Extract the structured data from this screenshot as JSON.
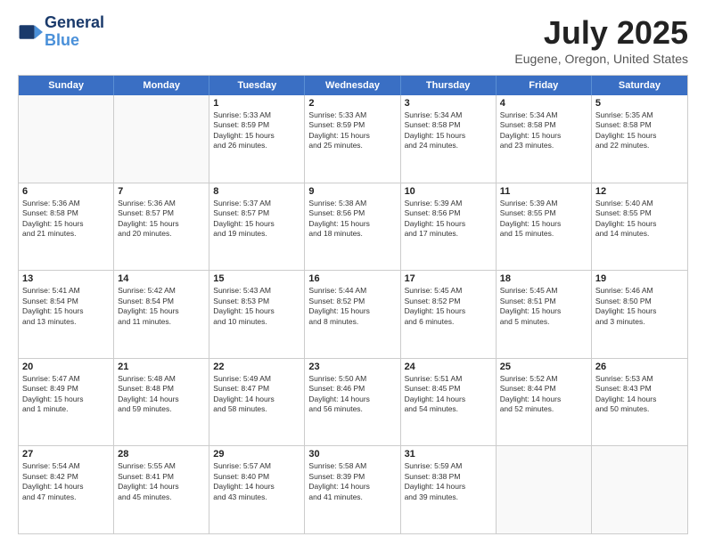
{
  "header": {
    "logo_line1": "General",
    "logo_line2": "Blue",
    "month_title": "July 2025",
    "location": "Eugene, Oregon, United States"
  },
  "days_of_week": [
    "Sunday",
    "Monday",
    "Tuesday",
    "Wednesday",
    "Thursday",
    "Friday",
    "Saturday"
  ],
  "weeks": [
    [
      {
        "day": "",
        "text": ""
      },
      {
        "day": "",
        "text": ""
      },
      {
        "day": "1",
        "text": "Sunrise: 5:33 AM\nSunset: 8:59 PM\nDaylight: 15 hours\nand 26 minutes."
      },
      {
        "day": "2",
        "text": "Sunrise: 5:33 AM\nSunset: 8:59 PM\nDaylight: 15 hours\nand 25 minutes."
      },
      {
        "day": "3",
        "text": "Sunrise: 5:34 AM\nSunset: 8:58 PM\nDaylight: 15 hours\nand 24 minutes."
      },
      {
        "day": "4",
        "text": "Sunrise: 5:34 AM\nSunset: 8:58 PM\nDaylight: 15 hours\nand 23 minutes."
      },
      {
        "day": "5",
        "text": "Sunrise: 5:35 AM\nSunset: 8:58 PM\nDaylight: 15 hours\nand 22 minutes."
      }
    ],
    [
      {
        "day": "6",
        "text": "Sunrise: 5:36 AM\nSunset: 8:58 PM\nDaylight: 15 hours\nand 21 minutes."
      },
      {
        "day": "7",
        "text": "Sunrise: 5:36 AM\nSunset: 8:57 PM\nDaylight: 15 hours\nand 20 minutes."
      },
      {
        "day": "8",
        "text": "Sunrise: 5:37 AM\nSunset: 8:57 PM\nDaylight: 15 hours\nand 19 minutes."
      },
      {
        "day": "9",
        "text": "Sunrise: 5:38 AM\nSunset: 8:56 PM\nDaylight: 15 hours\nand 18 minutes."
      },
      {
        "day": "10",
        "text": "Sunrise: 5:39 AM\nSunset: 8:56 PM\nDaylight: 15 hours\nand 17 minutes."
      },
      {
        "day": "11",
        "text": "Sunrise: 5:39 AM\nSunset: 8:55 PM\nDaylight: 15 hours\nand 15 minutes."
      },
      {
        "day": "12",
        "text": "Sunrise: 5:40 AM\nSunset: 8:55 PM\nDaylight: 15 hours\nand 14 minutes."
      }
    ],
    [
      {
        "day": "13",
        "text": "Sunrise: 5:41 AM\nSunset: 8:54 PM\nDaylight: 15 hours\nand 13 minutes."
      },
      {
        "day": "14",
        "text": "Sunrise: 5:42 AM\nSunset: 8:54 PM\nDaylight: 15 hours\nand 11 minutes."
      },
      {
        "day": "15",
        "text": "Sunrise: 5:43 AM\nSunset: 8:53 PM\nDaylight: 15 hours\nand 10 minutes."
      },
      {
        "day": "16",
        "text": "Sunrise: 5:44 AM\nSunset: 8:52 PM\nDaylight: 15 hours\nand 8 minutes."
      },
      {
        "day": "17",
        "text": "Sunrise: 5:45 AM\nSunset: 8:52 PM\nDaylight: 15 hours\nand 6 minutes."
      },
      {
        "day": "18",
        "text": "Sunrise: 5:45 AM\nSunset: 8:51 PM\nDaylight: 15 hours\nand 5 minutes."
      },
      {
        "day": "19",
        "text": "Sunrise: 5:46 AM\nSunset: 8:50 PM\nDaylight: 15 hours\nand 3 minutes."
      }
    ],
    [
      {
        "day": "20",
        "text": "Sunrise: 5:47 AM\nSunset: 8:49 PM\nDaylight: 15 hours\nand 1 minute."
      },
      {
        "day": "21",
        "text": "Sunrise: 5:48 AM\nSunset: 8:48 PM\nDaylight: 14 hours\nand 59 minutes."
      },
      {
        "day": "22",
        "text": "Sunrise: 5:49 AM\nSunset: 8:47 PM\nDaylight: 14 hours\nand 58 minutes."
      },
      {
        "day": "23",
        "text": "Sunrise: 5:50 AM\nSunset: 8:46 PM\nDaylight: 14 hours\nand 56 minutes."
      },
      {
        "day": "24",
        "text": "Sunrise: 5:51 AM\nSunset: 8:45 PM\nDaylight: 14 hours\nand 54 minutes."
      },
      {
        "day": "25",
        "text": "Sunrise: 5:52 AM\nSunset: 8:44 PM\nDaylight: 14 hours\nand 52 minutes."
      },
      {
        "day": "26",
        "text": "Sunrise: 5:53 AM\nSunset: 8:43 PM\nDaylight: 14 hours\nand 50 minutes."
      }
    ],
    [
      {
        "day": "27",
        "text": "Sunrise: 5:54 AM\nSunset: 8:42 PM\nDaylight: 14 hours\nand 47 minutes."
      },
      {
        "day": "28",
        "text": "Sunrise: 5:55 AM\nSunset: 8:41 PM\nDaylight: 14 hours\nand 45 minutes."
      },
      {
        "day": "29",
        "text": "Sunrise: 5:57 AM\nSunset: 8:40 PM\nDaylight: 14 hours\nand 43 minutes."
      },
      {
        "day": "30",
        "text": "Sunrise: 5:58 AM\nSunset: 8:39 PM\nDaylight: 14 hours\nand 41 minutes."
      },
      {
        "day": "31",
        "text": "Sunrise: 5:59 AM\nSunset: 8:38 PM\nDaylight: 14 hours\nand 39 minutes."
      },
      {
        "day": "",
        "text": ""
      },
      {
        "day": "",
        "text": ""
      }
    ]
  ]
}
